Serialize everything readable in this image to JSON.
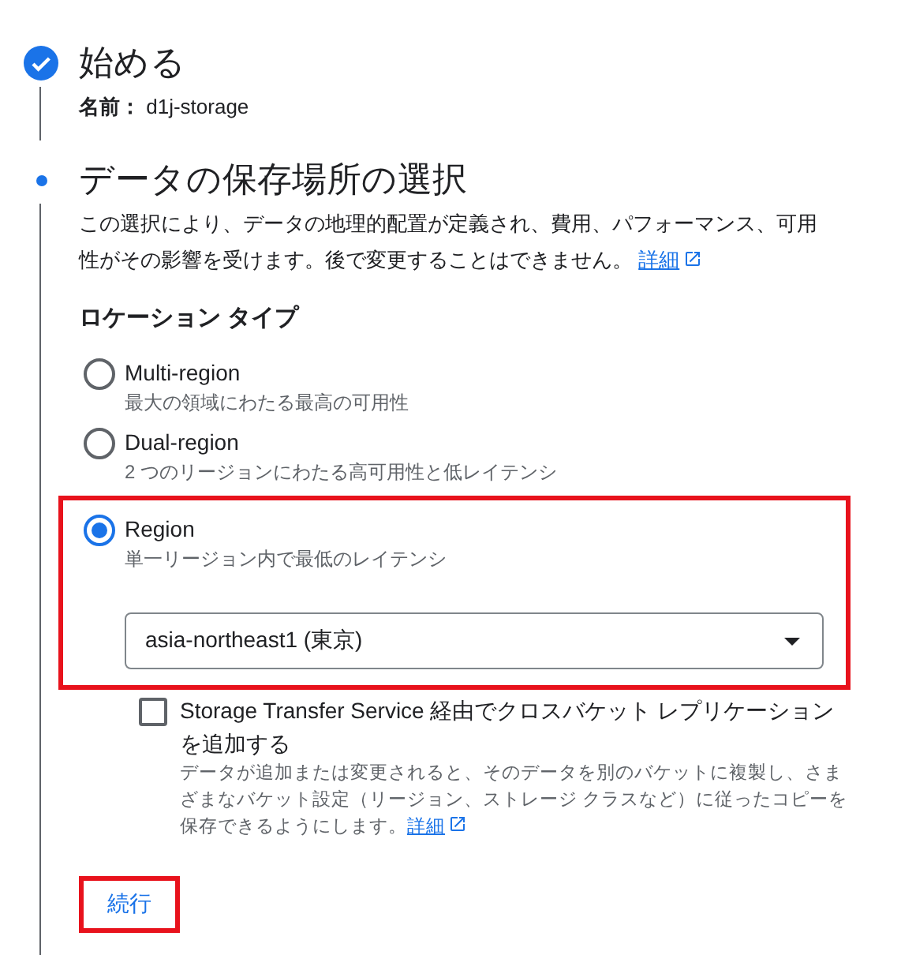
{
  "steps": [
    {
      "title": "始める",
      "kind": "done",
      "summary_label": "名前：",
      "summary_value": "d1j-storage"
    },
    {
      "title": "データの保存場所の選択",
      "kind": "current",
      "description": "この選択により、データの地理的配置が定義され、費用、パフォーマンス、可用性がその影響を受けます。後で変更することはできません。",
      "link": "詳細"
    }
  ],
  "location_type": {
    "heading": "ロケーション タイプ",
    "options": [
      {
        "label": "Multi-region",
        "description": "最大の領域にわたる最高の可用性",
        "selected": false,
        "highlighted": false
      },
      {
        "label": "Dual-region",
        "description": "2 つのリージョンにわたる高可用性と低レイテンシ",
        "selected": false,
        "highlighted": false
      },
      {
        "label": "Region",
        "description": "単一リージョン内で最低のレイテンシ",
        "selected": true,
        "highlighted": true,
        "region_select": "asia-northeast1 (東京)"
      }
    ]
  },
  "replication": {
    "label": "Storage Transfer Service 経由でクロスバケット レプリケーションを追加する",
    "checked": false,
    "description": "データが追加または変更されると、そのデータを別のバケットに複製し、さまざまなバケット設定（リージョン、ストレージ クラスなど）に従ったコピーを保存できるようにします。",
    "link": "詳細"
  },
  "continue_button": {
    "label": "続行",
    "highlighted": true
  }
}
